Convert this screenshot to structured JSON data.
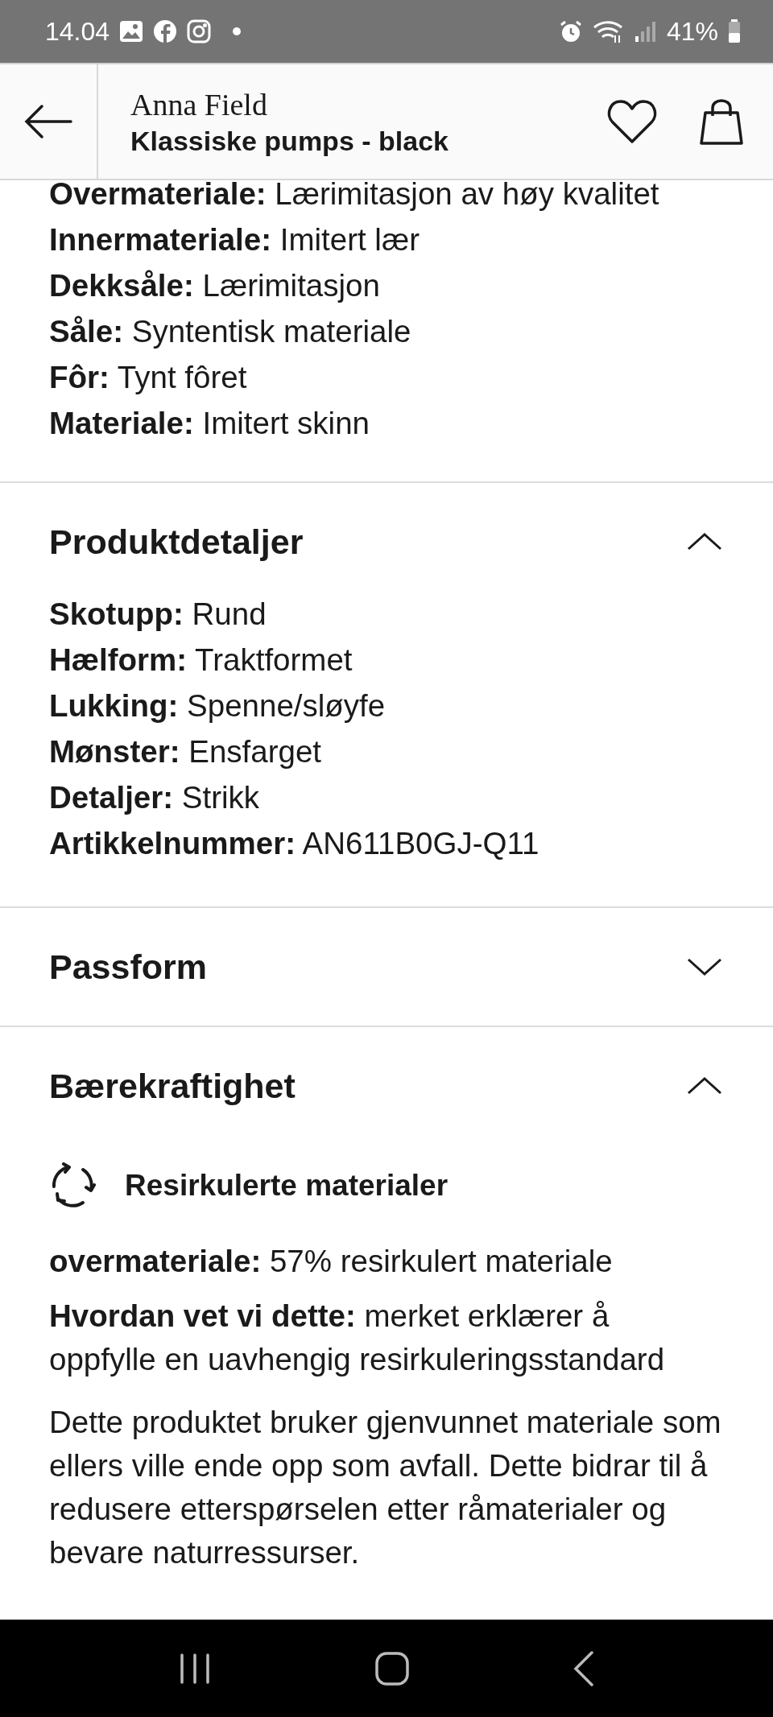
{
  "status_bar": {
    "time": "14.04",
    "battery": "41%"
  },
  "header": {
    "brand": "Anna Field",
    "title": "Klassiske pumps - black"
  },
  "materials": [
    "**Overmateriale:** Lærimitasjon av høy kvalitet",
    "**Innermateriale:** Imitert lær",
    "**Dekksåle:** Lærimitasjon",
    "**Såle:** Syntentisk materiale",
    "**Fôr:** Tynt fôret",
    "**Materiale:** Imitert skinn"
  ],
  "sections": [
    {
      "title": "Produktdetaljer",
      "expanded": true,
      "kind": "specs",
      "rows": [
        "**Skotupp:** Rund",
        "**Hælform:** Traktformet",
        "**Lukking:** Spenne/sløyfe",
        "**Mønster:** Ensfarget",
        "**Detaljer:** Strikk",
        "**Artikkelnummer:** AN611B0GJ-Q11"
      ]
    },
    {
      "title": "Passform",
      "expanded": false
    },
    {
      "title": "Bærekraftighet",
      "expanded": true,
      "kind": "sustainability",
      "feature": "Resirkulerte materialer",
      "rows": [
        "**overmateriale:** 57% resirkulert materiale",
        "**Hvordan vet vi dette:** merket erklærer å oppfylle en uavhengig resirkuleringsstandard"
      ],
      "paragraph": "Dette produktet bruker gjenvunnet materiale som ellers ville ende opp som avfall. Dette bidrar til å redusere etterspørselen etter råmaterialer og bevare naturressurser."
    }
  ]
}
